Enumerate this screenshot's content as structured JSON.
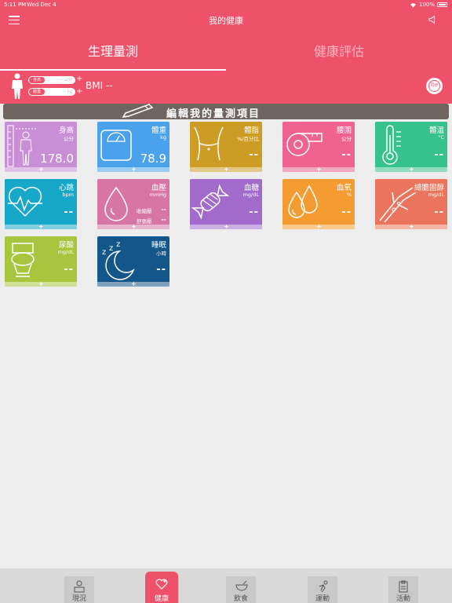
{
  "status_bar": {
    "time": "5:11 PM",
    "date": "Wed Dec 4",
    "battery": "100%"
  },
  "nav": {
    "title": "我的健康"
  },
  "tabs": [
    {
      "label": "生理量測",
      "active": true
    },
    {
      "label": "健康評估",
      "active": false
    }
  ],
  "profile": {
    "height_tag": "身高",
    "height_value": "-- 公分",
    "weight_tag": "體重",
    "weight_value": "-- kg",
    "bmi": "BMI --",
    "sync_label": "同步"
  },
  "edit_banner": "編輯我的量測項目",
  "cards": [
    {
      "name": "身高",
      "unit": "公分",
      "value": "178.0",
      "color": "#c98fd6"
    },
    {
      "name": "體重",
      "unit": "kg",
      "value": "78.9",
      "color": "#4aa2ec"
    },
    {
      "name": "體脂",
      "unit": "%/百分比",
      "value": "--",
      "color": "#cc9c25"
    },
    {
      "name": "腰圍",
      "unit": "公分",
      "value": "--",
      "color": "#f0628f"
    },
    {
      "name": "體溫",
      "unit": "°C",
      "value": "--",
      "color": "#35c28c"
    },
    {
      "name": "心跳",
      "unit": "bpm",
      "value": "--",
      "color": "#16a7c9"
    },
    {
      "name": "血壓",
      "unit": "mmHg",
      "value": "",
      "color": "#d776a5",
      "systolic_label": "收縮壓",
      "systolic_value": "--",
      "diastolic_label": "舒張壓",
      "diastolic_value": "--"
    },
    {
      "name": "血糖",
      "unit": "mg/dL",
      "value": "--",
      "color": "#a26bcb"
    },
    {
      "name": "血氧",
      "unit": "%",
      "value": "--",
      "color": "#f49c31"
    },
    {
      "name": "總膽固醇",
      "unit": "mg/dL",
      "value": "--",
      "color": "#ea755c"
    },
    {
      "name": "尿酸",
      "unit": "mg/dL",
      "value": "--",
      "color": "#a7c53e"
    },
    {
      "name": "睡眠",
      "unit": "小時",
      "value": "--",
      "color": "#13568a"
    }
  ],
  "bottom_nav": [
    {
      "label": "現況",
      "active": false
    },
    {
      "label": "健康",
      "active": true
    },
    {
      "label": "飲食",
      "active": false
    },
    {
      "label": "運動",
      "active": false
    },
    {
      "label": "活動",
      "active": false
    }
  ]
}
